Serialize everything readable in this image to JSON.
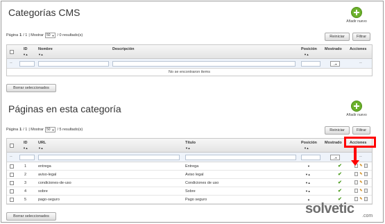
{
  "section1": {
    "title": "Categorías CMS",
    "add_label": "Añadir nuevo",
    "pager": {
      "page_label": "Página",
      "page_current": "1",
      "page_total": "/ 1",
      "show_label": "| Mostrar",
      "show_value": "50",
      "results": "/ 0 resultado(s)"
    },
    "reset_label": "Reiniciar",
    "filter_label": "Filtrar",
    "columns": {
      "id": "ID",
      "name": "Nombre",
      "description": "Descripción",
      "position": "Posición",
      "shown": "Mostrado",
      "actions": "Acciones"
    },
    "filter_dash": "--",
    "empty_message": "No se encontraron items",
    "bulk_delete": "Borrar seleccionados"
  },
  "section2": {
    "title": "Páginas en esta categoría",
    "add_label": "Añadir nuevo",
    "pager": {
      "page_label": "Página",
      "page_current": "1",
      "page_total": "/ 1",
      "show_label": "| Mostrar",
      "show_value": "50",
      "results": "/ 5 resultado(s)"
    },
    "reset_label": "Reiniciar",
    "filter_label": "Filtrar",
    "columns": {
      "id": "ID",
      "url": "URL",
      "title": "Título",
      "position": "Posición",
      "shown": "Mostrado",
      "actions": "Acciones"
    },
    "filter_dash": "--",
    "rows": [
      {
        "id": "1",
        "url": "entrega",
        "title": "Entrega"
      },
      {
        "id": "2",
        "url": "aviso-legal",
        "title": "Aviso legal"
      },
      {
        "id": "3",
        "url": "condiciones-de-uso",
        "title": "Condiciones de uso"
      },
      {
        "id": "4",
        "url": "sobre",
        "title": "Sobre"
      },
      {
        "id": "5",
        "url": "pago-seguro",
        "title": "Pago seguro"
      }
    ],
    "bulk_delete": "Borrar seleccionados"
  },
  "watermark": {
    "brand": "olvetic",
    "brand_initial": "s",
    "domain": ".com"
  },
  "colors": {
    "highlight": "#ff0000",
    "check": "#4b9b1d",
    "add_green": "#6cb12c"
  }
}
